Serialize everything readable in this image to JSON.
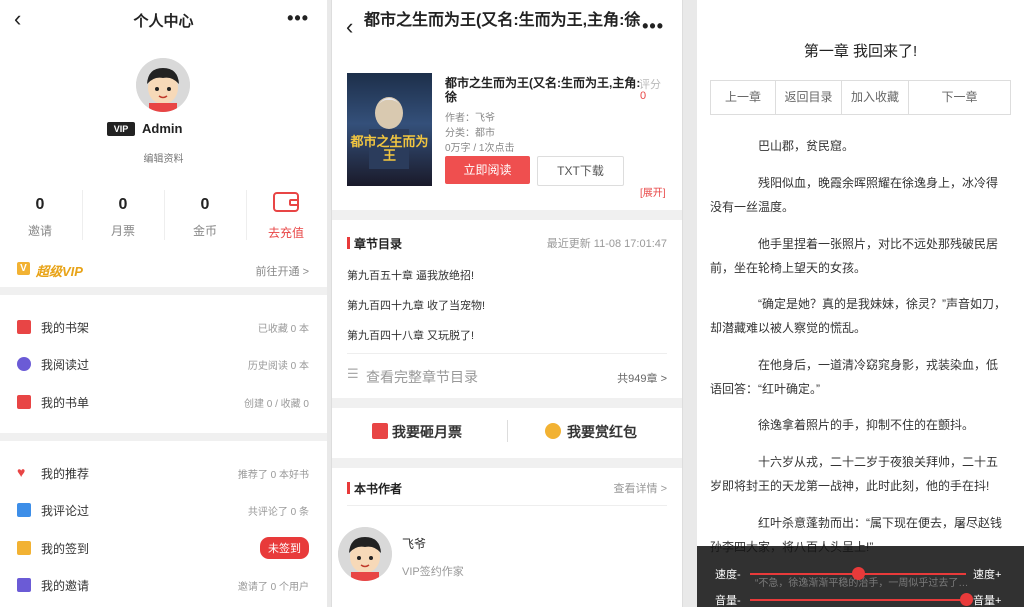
{
  "profile": {
    "title": "个人中心",
    "back_icon": "‹",
    "more_icon": "•••",
    "vip_tag": "VIP",
    "username": "Admin",
    "edit_label": "编辑资料",
    "stats": [
      {
        "value": "0",
        "label": "邀请"
      },
      {
        "value": "0",
        "label": "月票"
      },
      {
        "value": "0",
        "label": "金币"
      }
    ],
    "recharge_label": "去充值",
    "vip_banner": {
      "label": "超级VIP",
      "action": "前往开通 >"
    },
    "group1": [
      {
        "label": "我的书架",
        "value": "已收藏 0 本",
        "color": "#e84545"
      },
      {
        "label": "我阅读过",
        "value": "历史阅读 0 本",
        "color": "#6b5bd6"
      },
      {
        "label": "我的书单",
        "value": "创建 0 / 收藏 0",
        "color": "#e84545"
      }
    ],
    "group2": [
      {
        "label": "我的推荐",
        "value": "推荐了 0 本好书",
        "color": "#e84545"
      },
      {
        "label": "我评论过",
        "value": "共评论了 0 条",
        "color": "#3d8ee8"
      },
      {
        "label": "我的签到",
        "value": "未签到",
        "color": "#f2b233"
      },
      {
        "label": "我的邀请",
        "value": "邀请了 0 个用户",
        "color": "#6b5bd6"
      }
    ]
  },
  "book": {
    "header_title": "都市之生而为王(又名:生而为王,主角:徐",
    "cover_text": "都市之生而为王",
    "title": "都市之生而为王(又名:生而为王,主角:徐",
    "rating_label": "评分",
    "rating_value": "0",
    "author_line": "作者：飞爷",
    "category_line": "分类：都市",
    "stats_line": "0万字 / 1次点击",
    "read_button": "立即阅读",
    "download_button": "TXT下载",
    "expand_label": "[展开]",
    "toc_title": "章节目录",
    "updated": "最近更新 11-08 17:01:47",
    "chapters": [
      "第九百五十章 逼我放绝招!",
      "第九百四十九章 收了当宠物!",
      "第九百四十八章 又玩脱了!"
    ],
    "full_toc_label": "查看完整章节目录",
    "chapter_count": "共949章 >",
    "vote_ticket": "我要砸月票",
    "reward": "我要赏红包",
    "author_section_title": "本书作者",
    "author_details": "查看详情 >",
    "author_name": "飞爷",
    "author_tag": "VIP签约作家"
  },
  "reader": {
    "chapter_title": "第一章 我回来了!",
    "nav": [
      "上一章",
      "返回目录",
      "加入收藏",
      "下一章"
    ],
    "paragraphs": [
      "巴山郡，贫民窟。",
      "残阳似血，晚霞余晖照耀在徐逸身上，冰冷得没有一丝温度。",
      "他手里捏着一张照片，对比不远处那残破民居前，坐在轮椅上望天的女孩。",
      "“确定是她？真的是我妹妹，徐灵？”声音如刀，却潜藏难以被人察觉的慌乱。",
      "在他身后，一道清冷窈窕身影，戎装染血，低语回答：“红叶确定。”",
      "徐逸拿着照片的手，抑制不住的在颤抖。",
      "十六岁从戎，二十二岁于夜狼关拜帅，二十五岁即将封王的天龙第一战神，此时此刻，他的手在抖!",
      "红叶杀意蓬勃而出：“属下现在便去，屠尽赵钱孙李四大家，将八百人头呈上!”"
    ],
    "controls": {
      "speed_minus": "速度-",
      "speed_plus": "速度+",
      "volume_minus": "音量-",
      "volume_plus": "音量+",
      "speed_level": 0.5,
      "volume_level": 1.0,
      "overlay_text": "“不急，徐逸渐渐平稳的治手，一周似乎过去了…"
    }
  }
}
